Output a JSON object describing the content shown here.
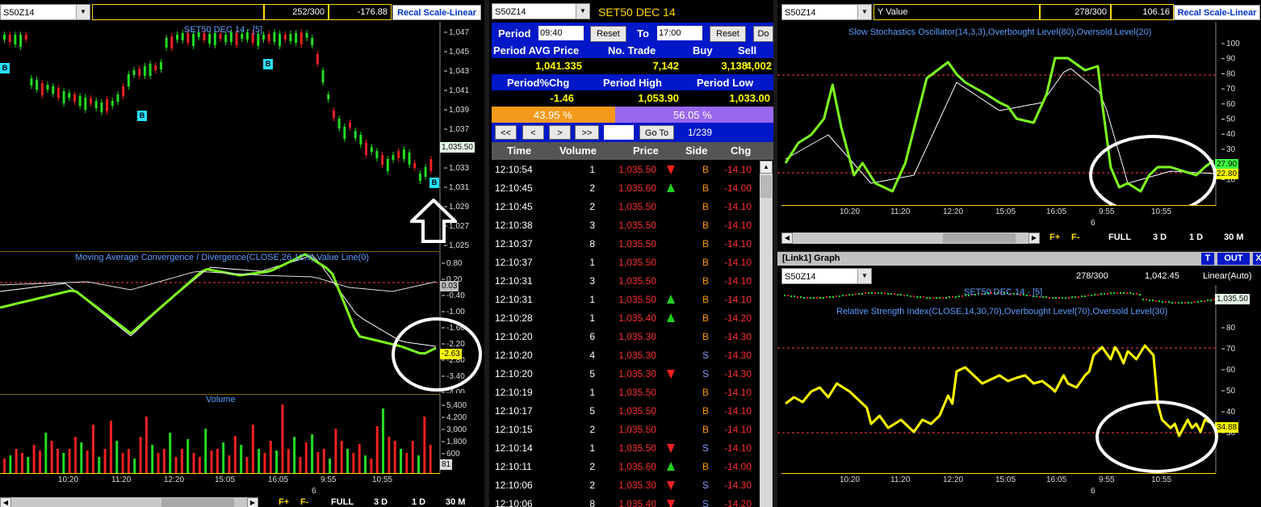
{
  "left": {
    "symbol": "S50Z14",
    "count": "252/300",
    "value": "-176.88",
    "recal": "Recal Scale-Linear",
    "price_title": "SET50 DEC 14 - [5]",
    "price_axis": [
      "1,047",
      "1,045",
      "1,043",
      "1,041",
      "1,039",
      "1,037",
      "1,035",
      "1,033",
      "1,031",
      "1,029",
      "1,027",
      "1,025"
    ],
    "price_tag": "1,035.50",
    "macd_title": "Moving Average Convergence / Divergence(CLOSE,26,12,9),Value Line(0)",
    "macd_axis": [
      "0.80",
      "0.20",
      "-0.40",
      "-1.00",
      "-1.60",
      "-2.20",
      "-2.80",
      "-3.40",
      "-4.00"
    ],
    "macd_tag_a": "0.03",
    "macd_tag_b": "-2.63",
    "vol_title": "Volume",
    "vol_axis": [
      "5,400",
      "4,200",
      "3,000",
      "1,800",
      "600"
    ],
    "vol_tag": "81",
    "x_labels": [
      "10:20",
      "11:20",
      "12:20",
      "15:05",
      "16:05",
      "9:55",
      "10:55"
    ],
    "day_label": "6",
    "b_markers": [
      "B",
      "B",
      "B",
      "B"
    ],
    "toolbar": [
      "F+",
      "F-",
      "FULL",
      "3 D",
      "1 D",
      "30 M"
    ]
  },
  "middle": {
    "symbol": "S50Z14",
    "instrument": "SET50 DEC 14",
    "period_label": "Period",
    "from_time": "09:40",
    "reset": "Reset",
    "to_label": "To",
    "to_time": "17:00",
    "do_label": "Do",
    "stats_headers": [
      "Period AVG Price",
      "No. Trade",
      "Buy",
      "Sell"
    ],
    "stats_values": [
      "1,041.335",
      "7,142",
      "3,138",
      "4,002"
    ],
    "stats_headers2": [
      "Period%Chg",
      "Period High",
      "Period Low"
    ],
    "stats_values2": [
      "-1.46",
      "1,053.90",
      "1,033.00"
    ],
    "buy_pct": "43.95 %",
    "sell_pct": "56.05 %",
    "buy_fraction": 0.4395,
    "nav": [
      "<<",
      "<",
      ">",
      ">>"
    ],
    "goto": "Go To",
    "page": "1/239",
    "columns": [
      "Time",
      "Volume",
      "Price",
      "Side",
      "Chg"
    ],
    "trades": [
      {
        "time": "12:10:54",
        "vol": "1",
        "price": "1,035.50",
        "dir": "down",
        "side": "B",
        "chg": "-14.10"
      },
      {
        "time": "12:10:45",
        "vol": "2",
        "price": "1,035.60",
        "dir": "up",
        "side": "B",
        "chg": "-14.00"
      },
      {
        "time": "12:10:45",
        "vol": "2",
        "price": "1,035.50",
        "dir": "",
        "side": "B",
        "chg": "-14.10"
      },
      {
        "time": "12:10:38",
        "vol": "3",
        "price": "1,035.50",
        "dir": "",
        "side": "B",
        "chg": "-14.10"
      },
      {
        "time": "12:10:37",
        "vol": "8",
        "price": "1,035.50",
        "dir": "",
        "side": "B",
        "chg": "-14.10"
      },
      {
        "time": "12:10:37",
        "vol": "1",
        "price": "1,035.50",
        "dir": "",
        "side": "B",
        "chg": "-14.10"
      },
      {
        "time": "12:10:31",
        "vol": "3",
        "price": "1,035.50",
        "dir": "",
        "side": "B",
        "chg": "-14.10"
      },
      {
        "time": "12:10:31",
        "vol": "1",
        "price": "1,035.50",
        "dir": "up",
        "side": "B",
        "chg": "-14.10"
      },
      {
        "time": "12:10:28",
        "vol": "1",
        "price": "1,035.40",
        "dir": "up",
        "side": "B",
        "chg": "-14.20"
      },
      {
        "time": "12:10:20",
        "vol": "6",
        "price": "1,035.30",
        "dir": "",
        "side": "B",
        "chg": "-14.30"
      },
      {
        "time": "12:10:20",
        "vol": "4",
        "price": "1,035.30",
        "dir": "",
        "side": "S",
        "chg": "-14.30"
      },
      {
        "time": "12:10:20",
        "vol": "5",
        "price": "1,035.30",
        "dir": "down",
        "side": "S",
        "chg": "-14.30"
      },
      {
        "time": "12:10:19",
        "vol": "1",
        "price": "1,035.50",
        "dir": "",
        "side": "B",
        "chg": "-14.10"
      },
      {
        "time": "12:10:17",
        "vol": "5",
        "price": "1,035.50",
        "dir": "",
        "side": "B",
        "chg": "-14.10"
      },
      {
        "time": "12:10:15",
        "vol": "2",
        "price": "1,035.50",
        "dir": "",
        "side": "B",
        "chg": "-14.10"
      },
      {
        "time": "12:10:14",
        "vol": "1",
        "price": "1,035.50",
        "dir": "down",
        "side": "S",
        "chg": "-14.10"
      },
      {
        "time": "12:10:11",
        "vol": "2",
        "price": "1,035.60",
        "dir": "up",
        "side": "B",
        "chg": "-14.00"
      },
      {
        "time": "12:10:06",
        "vol": "2",
        "price": "1,035.30",
        "dir": "down",
        "side": "S",
        "chg": "-14.30"
      },
      {
        "time": "12:10:06",
        "vol": "8",
        "price": "1,035.40",
        "dir": "down",
        "side": "S",
        "chg": "-14.20"
      }
    ]
  },
  "right_top": {
    "symbol": "S50Z14",
    "yvalue_label": "Y Value",
    "count": "278/300",
    "value": "106.16",
    "recal": "Recal Scale-Linear",
    "title": "Slow Stochastics Oscillator(14,3,3),Overbought Level(80),Oversold Level(20)",
    "axis": [
      "100",
      "90",
      "80",
      "70",
      "60",
      "50",
      "40",
      "30",
      "20",
      "10"
    ],
    "tag_a": "27.90",
    "tag_b": "22.80",
    "x_labels": [
      "10:20",
      "11:20",
      "12:20",
      "15:05",
      "16:05",
      "9:55",
      "10:55"
    ],
    "day_label": "6",
    "toolbar": [
      "F+",
      "F-",
      "FULL",
      "3 D",
      "1 D",
      "30 M"
    ]
  },
  "right_bottom": {
    "window_title": "[Link1] Graph",
    "t_btn": "T",
    "out_btn": "OUT",
    "x_btn": "X",
    "symbol": "S50Z14",
    "count": "278/300",
    "value": "1,042.45",
    "scale": "Linear(Auto)",
    "mini_title": "SET50 DEC 14 - [5]",
    "mini_tag": "1,035.50",
    "title": "Relative Strength Index(CLOSE,14,30,70),Overbought Level(70),Oversold Level(30)",
    "axis": [
      "80",
      "70",
      "60",
      "50",
      "40",
      "30"
    ],
    "tag": "34.88",
    "x_labels": [
      "10:20",
      "11:20",
      "12:20",
      "15:05",
      "16:05",
      "9:55",
      "10:55"
    ],
    "day_label": "6"
  }
}
